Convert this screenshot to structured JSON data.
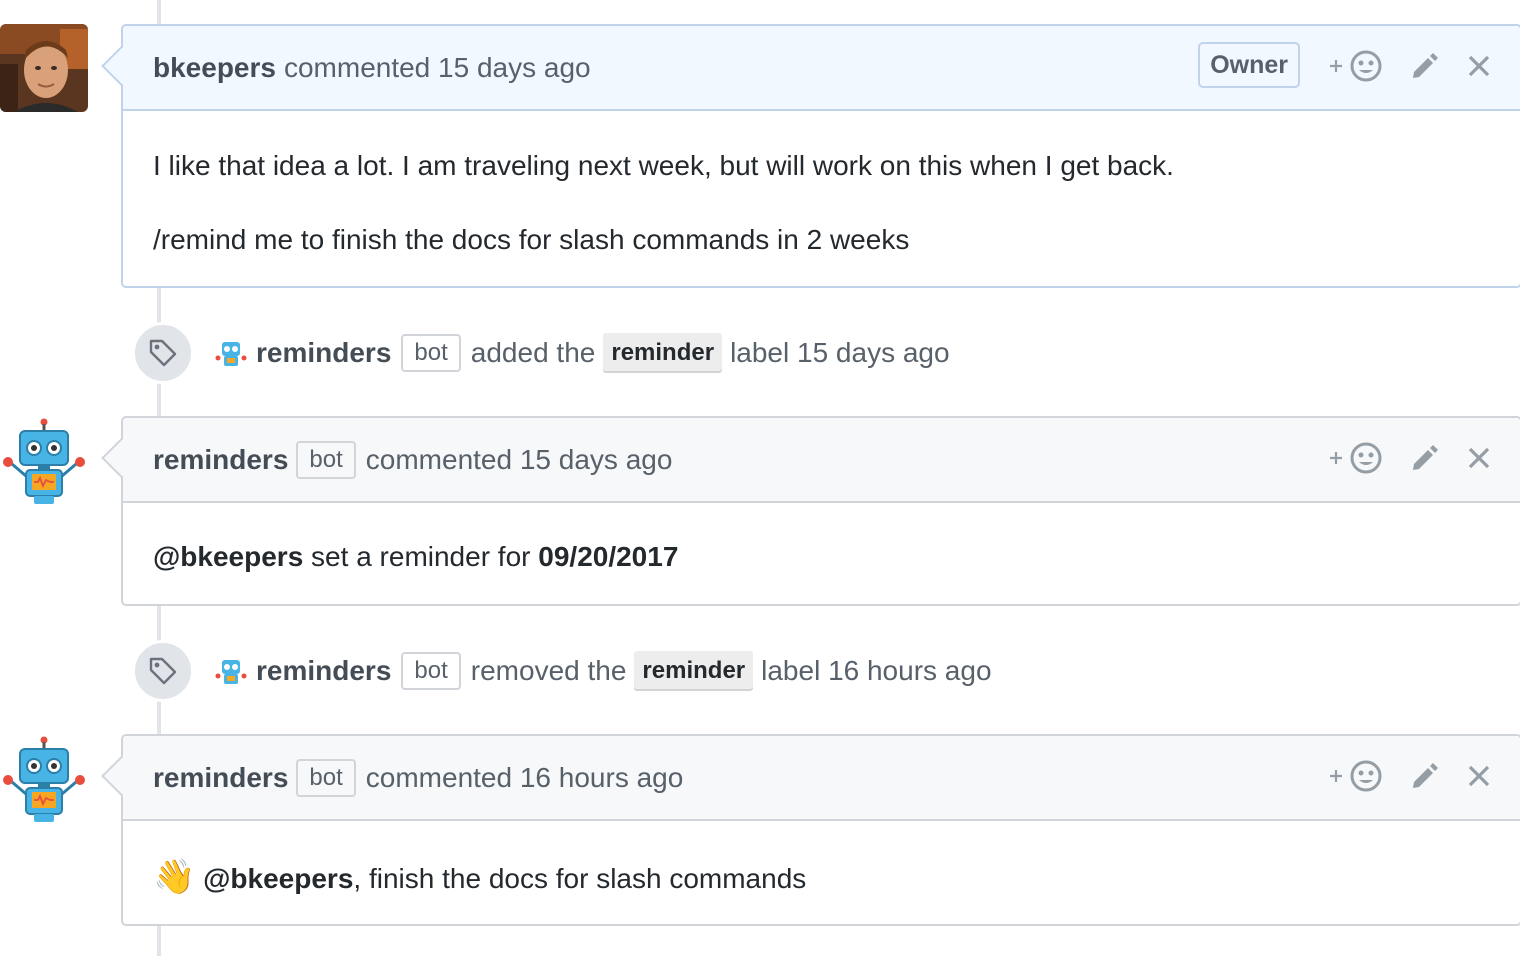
{
  "comments": [
    {
      "author": "bkeepers",
      "meta": "commented 15 days ago",
      "owner_label": "Owner",
      "body_line1": "I like that idea a lot. I am traveling next week, but will work on this when I get back.",
      "body_line2": "/remind me to finish the docs for slash commands in 2 weeks"
    },
    {
      "author": "reminders",
      "bot_label": "bot",
      "meta": "commented 15 days ago",
      "mention": "@bkeepers",
      "body_text": " set a reminder for ",
      "date": "09/20/2017"
    },
    {
      "author": "reminders",
      "bot_label": "bot",
      "meta": "commented 16 hours ago",
      "emoji": "👋",
      "mention": "@bkeepers",
      "body_text": ", finish the docs for slash commands"
    }
  ],
  "events": [
    {
      "author": "reminders",
      "bot_label": "bot",
      "action": "added the",
      "label": "reminder",
      "suffix": "label 15 days ago"
    },
    {
      "author": "reminders",
      "bot_label": "bot",
      "action": "removed the",
      "label": "reminder",
      "suffix": "label 16 hours ago"
    }
  ],
  "icons": {
    "reaction": "smiley-plus-icon",
    "edit": "pencil-icon",
    "delete": "close-icon",
    "event": "tag-icon"
  },
  "colors": {
    "owner_header": "#f1f8ff",
    "header": "#f6f8fa",
    "label_bg": "#ededed"
  }
}
